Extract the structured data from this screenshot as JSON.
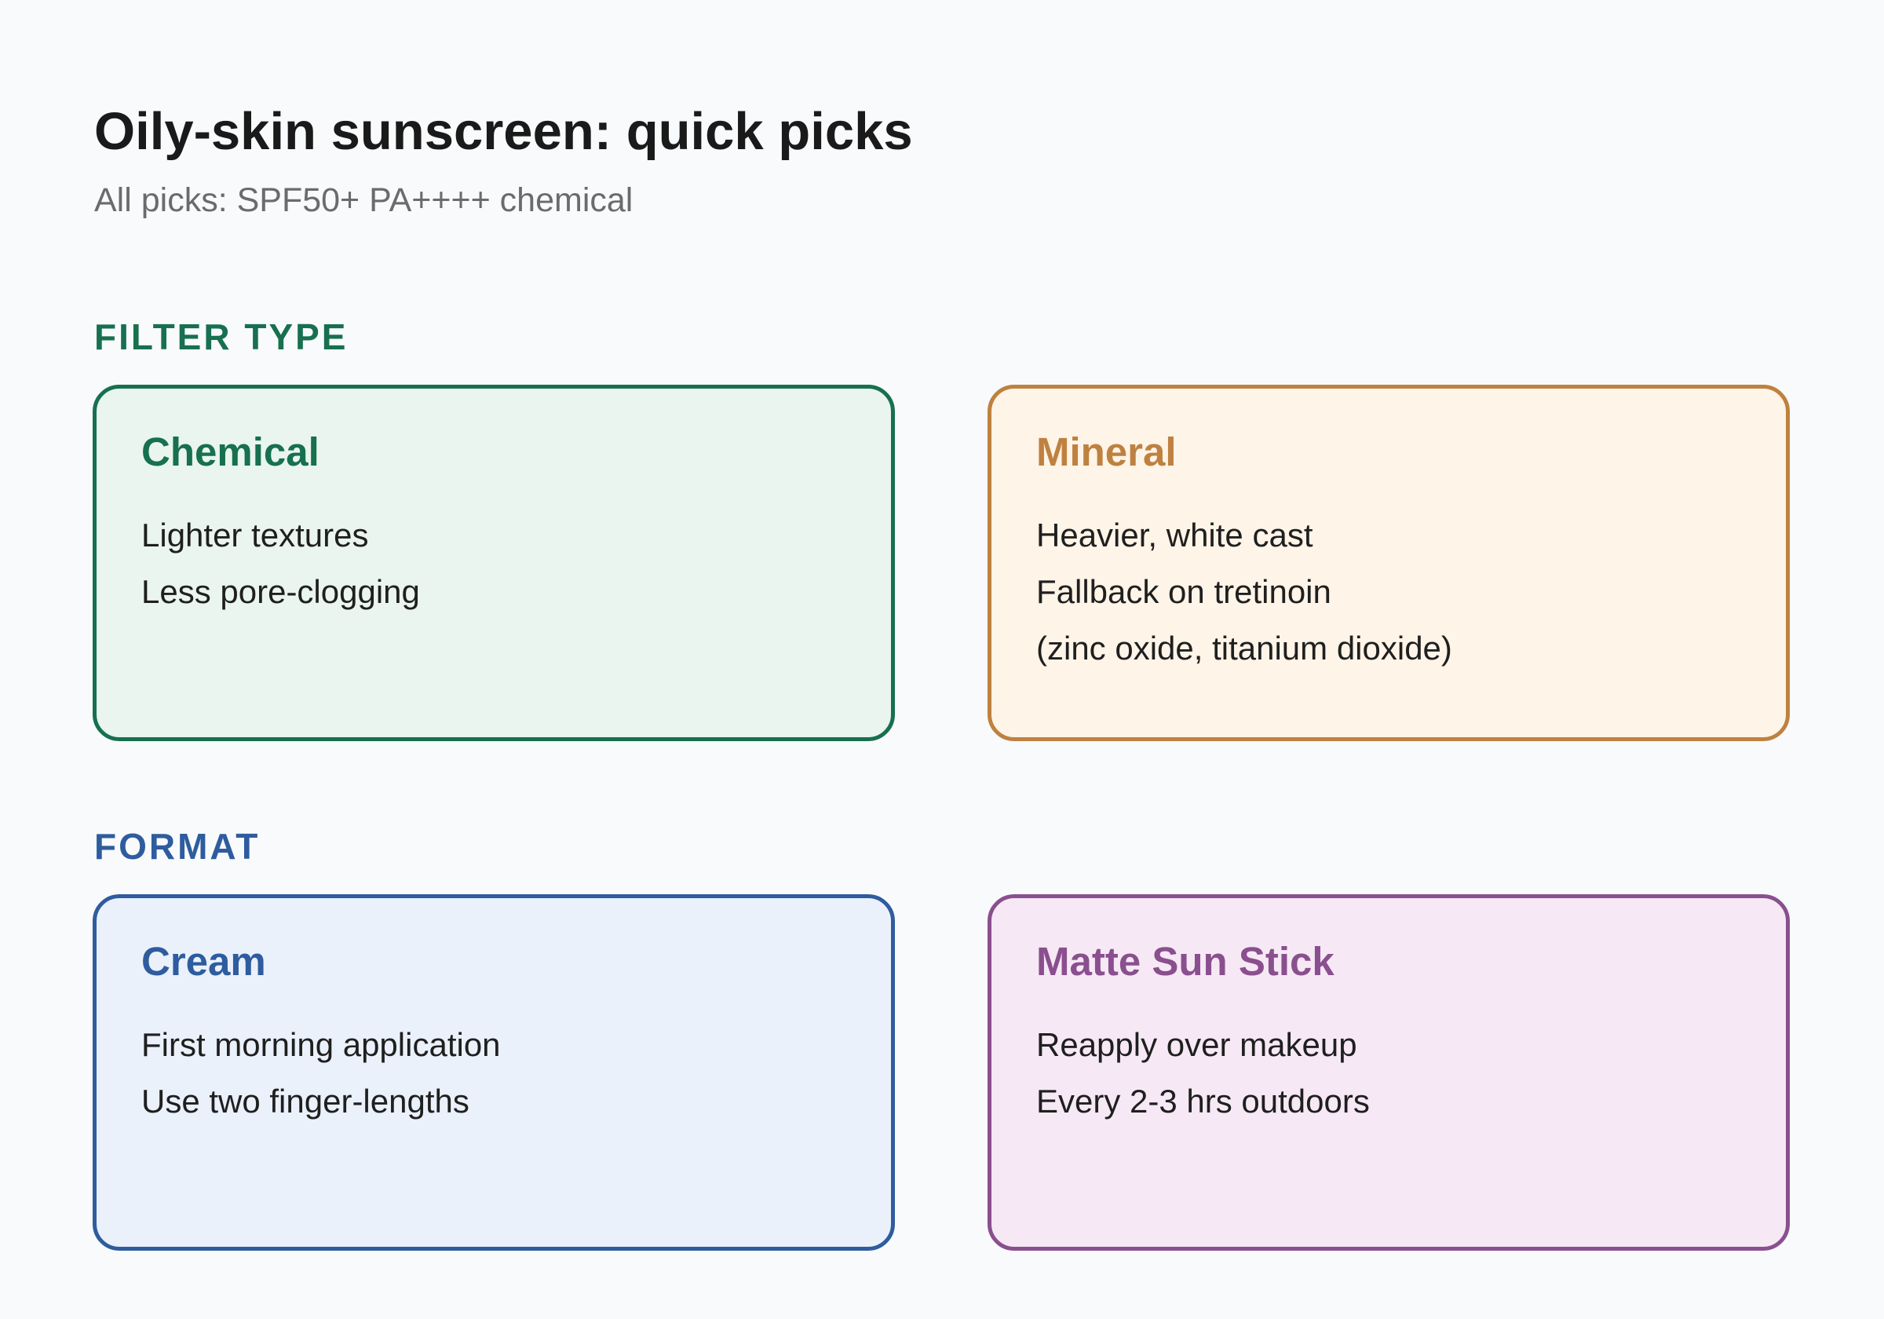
{
  "header": {
    "title": "Oily-skin sunscreen: quick picks",
    "subtitle": "All picks: SPF50+ PA++++ chemical"
  },
  "sections": [
    {
      "label": "FILTER TYPE",
      "color": "#17704f",
      "cards": [
        {
          "title": "Chemical",
          "lines": [
            "Lighter textures",
            "Less pore-clogging"
          ],
          "border_color": "#17704f",
          "fill_color": "#e9f5ee",
          "title_color": "#17704f"
        },
        {
          "title": "Mineral",
          "lines": [
            "Heavier, white cast",
            "Fallback on tretinoin",
            "(zinc oxide, titanium dioxide)"
          ],
          "border_color": "#bf8140",
          "fill_color": "#fff4e8",
          "title_color": "#bf8140"
        }
      ]
    },
    {
      "label": "FORMAT",
      "color": "#2e5c9e",
      "cards": [
        {
          "title": "Cream",
          "lines": [
            "First morning application",
            "Use two finger-lengths"
          ],
          "border_color": "#2e5c9e",
          "fill_color": "#eaf1fb",
          "title_color": "#2e5c9e"
        },
        {
          "title": "Matte Sun Stick",
          "lines": [
            "Reapply over makeup",
            "Every 2-3 hrs outdoors"
          ],
          "border_color": "#8a4f8e",
          "fill_color": "#f6e9f5",
          "title_color": "#8a4f8e"
        }
      ]
    }
  ]
}
